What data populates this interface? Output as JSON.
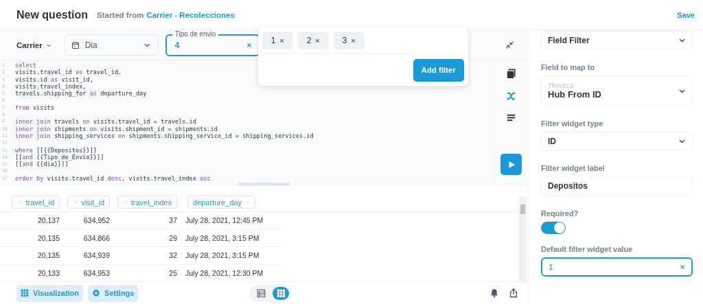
{
  "header": {
    "title": "New question",
    "subtitle_prefix": "Started from",
    "source_link": "Carrier - Recolecciones",
    "save": "Save"
  },
  "filters": [
    {
      "kind": "dropdown",
      "label": "Carrier"
    },
    {
      "kind": "date",
      "value": "Dia"
    },
    {
      "kind": "text",
      "label": "Tipo de envio",
      "value": "4",
      "focused": true
    }
  ],
  "popover": {
    "chips": [
      "1",
      "2",
      "3"
    ],
    "button": "Add filter"
  },
  "editor": {
    "lines": [
      {
        "number": "1",
        "segments": [
          {
            "kind": "keyword",
            "text": "select"
          }
        ]
      },
      {
        "number": "2",
        "segments": [
          {
            "kind": "plain",
            "text": "visits.travel_id "
          },
          {
            "kind": "keyword",
            "text": "as"
          },
          {
            "kind": "plain",
            "text": " travel_id,"
          }
        ]
      },
      {
        "number": "3",
        "segments": [
          {
            "kind": "plain",
            "text": "visits.id "
          },
          {
            "kind": "keyword",
            "text": "as"
          },
          {
            "kind": "plain",
            "text": " visit_id,"
          }
        ]
      },
      {
        "number": "4",
        "segments": [
          {
            "kind": "plain",
            "text": "visits.travel_index,"
          }
        ]
      },
      {
        "number": "5",
        "segments": [
          {
            "kind": "plain",
            "text": "travels.shipping_for "
          },
          {
            "kind": "keyword",
            "text": "as"
          },
          {
            "kind": "plain",
            "text": " departure_day"
          }
        ]
      },
      {
        "number": "6"
      },
      {
        "number": "7",
        "segments": [
          {
            "kind": "keyword",
            "text": "from"
          },
          {
            "kind": "plain",
            "text": " visits"
          }
        ]
      },
      {
        "number": "8"
      },
      {
        "number": "9",
        "segments": [
          {
            "kind": "keyword",
            "text": "inner join"
          },
          {
            "kind": "plain",
            "text": " travels "
          },
          {
            "kind": "keyword",
            "text": "on"
          },
          {
            "kind": "plain",
            "text": " visits.travel_id = travels.id"
          }
        ]
      },
      {
        "number": "10",
        "segments": [
          {
            "kind": "keyword",
            "text": "inner join"
          },
          {
            "kind": "plain",
            "text": " shipments "
          },
          {
            "kind": "keyword",
            "text": "on"
          },
          {
            "kind": "plain",
            "text": " visits.shipment_id = shipments.id"
          }
        ]
      },
      {
        "number": "11",
        "segments": [
          {
            "kind": "keyword",
            "text": "inner join"
          },
          {
            "kind": "plain",
            "text": " shipping_services "
          },
          {
            "kind": "keyword",
            "text": "on"
          },
          {
            "kind": "plain",
            "text": " shipments.shipping_service_id = shipping_services.id"
          }
        ]
      },
      {
        "number": "12"
      },
      {
        "number": "13",
        "segments": [
          {
            "kind": "keyword",
            "text": "where"
          },
          {
            "kind": "plain",
            "text": " [[{{Depositos}}]]"
          }
        ]
      },
      {
        "number": "14",
        "segments": [
          {
            "kind": "plain",
            "text": "[["
          },
          {
            "kind": "keyword",
            "text": "and"
          },
          {
            "kind": "plain",
            "text": " {{Tipo_de_Envio}}]]"
          }
        ]
      },
      {
        "number": "15",
        "segments": [
          {
            "kind": "plain",
            "text": "[["
          },
          {
            "kind": "keyword",
            "text": "and"
          },
          {
            "kind": "plain",
            "text": " {{dia}}]]"
          }
        ]
      },
      {
        "number": "16"
      },
      {
        "number": "17",
        "segments": [
          {
            "kind": "keyword",
            "text": "order by"
          },
          {
            "kind": "plain",
            "text": " visits.travel_id "
          },
          {
            "kind": "keyword",
            "text": "desc"
          },
          {
            "kind": "plain",
            "text": ", visits.travel_index "
          },
          {
            "kind": "keyword",
            "text": "asc"
          }
        ]
      }
    ]
  },
  "table": {
    "columns": [
      "travel_id",
      "visit_id",
      "travel_index",
      "departure_day"
    ],
    "rows": [
      [
        "20,137",
        "634,952",
        "37",
        "July 28, 2021, 12:45 PM"
      ],
      [
        "20,135",
        "634,866",
        "29",
        "July 28, 2021, 3:15 PM"
      ],
      [
        "20,135",
        "634,939",
        "32",
        "July 28, 2021, 3:15 PM"
      ],
      [
        "20,133",
        "634,953",
        "25",
        "July 28, 2021, 12:30 PM"
      ]
    ]
  },
  "bottom_bar": {
    "buttons": [
      "Visualization",
      "Settings"
    ],
    "view_toggle": [
      {
        "kind": "table",
        "selected": false
      },
      {
        "kind": "grid",
        "selected": true
      }
    ]
  },
  "settings_panel": {
    "fields": [
      {
        "kind": "select",
        "value": "Field Filter"
      },
      {
        "kind": "select",
        "label": "Field to map to",
        "section": "TRAVELS",
        "value": "Hub From ID"
      },
      {
        "kind": "select",
        "label": "Filter widget type",
        "value": "ID"
      },
      {
        "kind": "input",
        "label": "Filter widget label",
        "value": "Depositos"
      },
      {
        "kind": "toggle",
        "label": "Required?",
        "on": true
      },
      {
        "kind": "input",
        "label": "Default filter widget value",
        "value": "1",
        "focused": true
      }
    ]
  }
}
